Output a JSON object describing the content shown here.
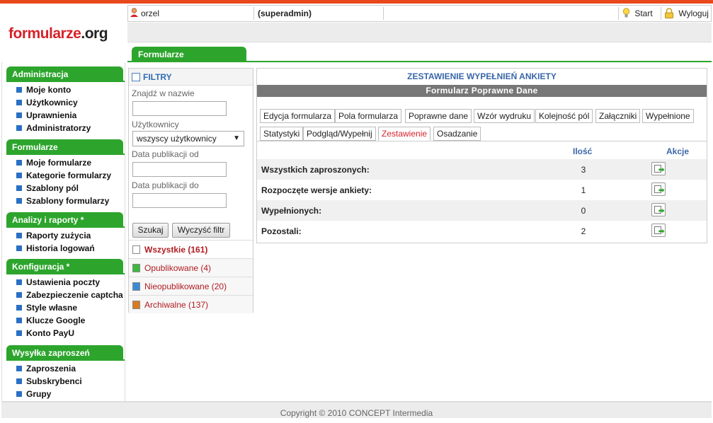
{
  "header": {
    "user": "orzel",
    "role": "(superadmin)",
    "start_label": "Start",
    "logout_label": "Wyloguj",
    "logo_part1": "formularze",
    "logo_part2": ".org",
    "main_tab": "Formularze"
  },
  "sidebar": {
    "sections": [
      {
        "title": "Administracja",
        "items": [
          "Moje konto",
          "Użytkownicy",
          "Uprawnienia",
          "Administratorzy"
        ]
      },
      {
        "title": "Formularze",
        "items": [
          "Moje formularze",
          "Kategorie formularzy",
          "Szablony pól",
          "Szablony formularzy"
        ]
      },
      {
        "title": "Analizy i raporty *",
        "items": [
          "Raporty zużycia",
          "Historia logowań"
        ]
      },
      {
        "title": "Konfiguracja *",
        "items": [
          "Ustawienia poczty",
          "Zabezpieczenie captcha",
          "Style własne",
          "Klucze Google",
          "Konto PayU"
        ]
      },
      {
        "title": "Wysyłka zaproszeń",
        "items": [
          "Zaproszenia",
          "Subskrybenci",
          "Grupy"
        ]
      }
    ]
  },
  "filters": {
    "title": "FILTRY",
    "name_label": "Znajdź w nazwie",
    "name_value": "",
    "users_label": "Użytkownicy",
    "users_value": "wszyscy użytkownicy",
    "date_from_label": "Data publikacji od",
    "date_from_value": "",
    "date_to_label": "Data publikacji do",
    "date_to_value": "",
    "search_button": "Szukaj",
    "clear_button": "Wyczyść filtr",
    "statuses": [
      {
        "label": "Wszystkie (161)",
        "color": "#ffffff"
      },
      {
        "label": "Opublikowane (4)",
        "color": "#3db83d"
      },
      {
        "label": "Nieopublikowane (20)",
        "color": "#3a8ad6"
      },
      {
        "label": "Archiwalne (137)",
        "color": "#d97a1f"
      }
    ]
  },
  "panel": {
    "title": "ZESTAWIENIE WYPEŁNIEŃ ANKIETY",
    "subtitle": "Formularz Poprawne Dane",
    "tabs": [
      "Edycja formularza",
      "Pola formularza",
      "Poprawne dane",
      "Wzór wydruku",
      "Kolejność pól",
      "Załączniki",
      "Wypełnione",
      "Statystyki",
      "Podgląd/Wypełnij",
      "Zestawienie",
      "Osadzanie"
    ],
    "active_tab": "Zestawienie",
    "col_count": "Ilość",
    "col_actions": "Akcje",
    "rows": [
      {
        "label": "Wszystkich zaproszonych:",
        "count": "3"
      },
      {
        "label": "Rozpoczęte wersje ankiety:",
        "count": "1"
      },
      {
        "label": "Wypełnionych:",
        "count": "0"
      },
      {
        "label": "Pozostali:",
        "count": "2"
      }
    ]
  },
  "footer": {
    "copyright": "Copyright © 2010 CONCEPT Intermedia"
  },
  "colors": {
    "accent_green": "#2da52d",
    "top_red": "#e8481c",
    "link_blue": "#3a66a8",
    "status_red": "#b01c22"
  }
}
